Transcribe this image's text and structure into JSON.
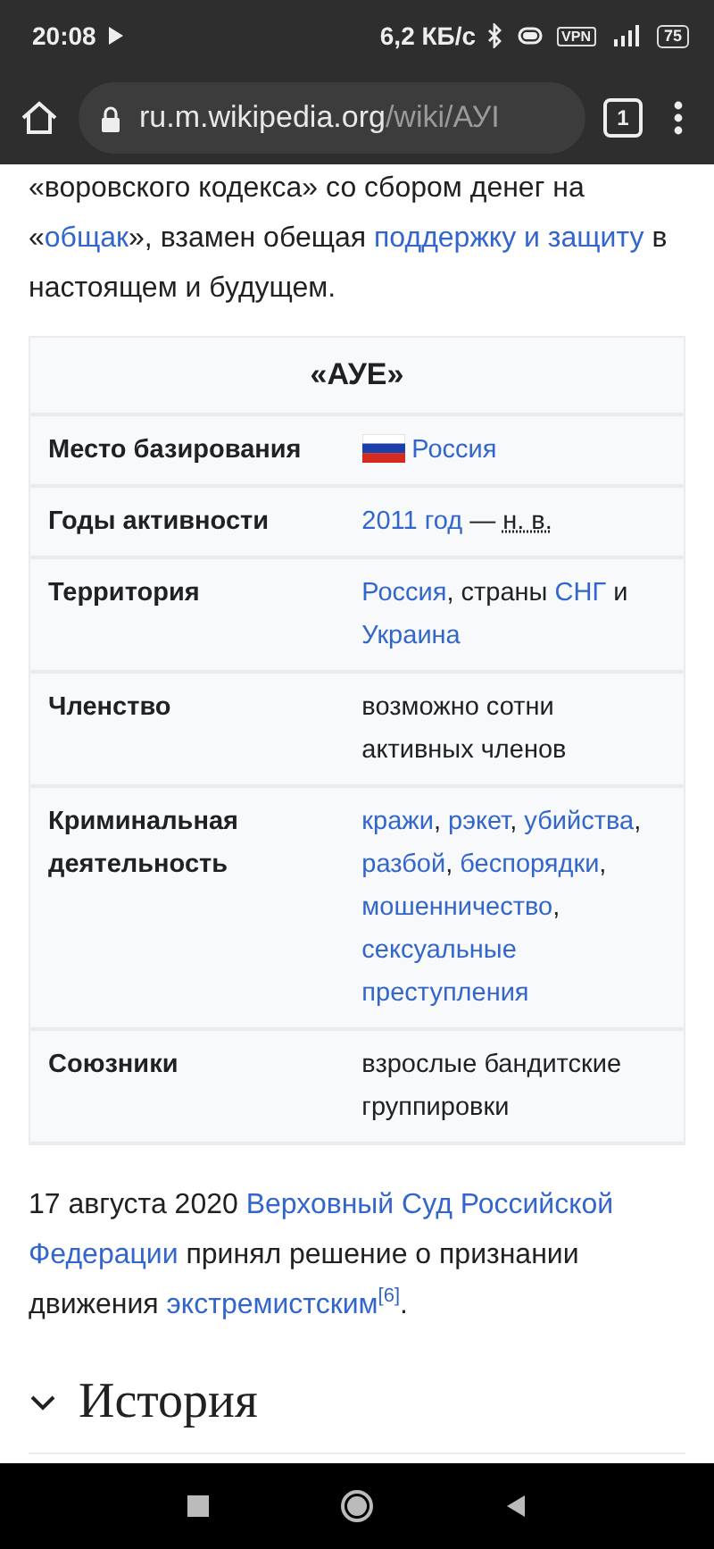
{
  "status_bar": {
    "time": "20:08",
    "speed": "6,2 КБ/с",
    "vpn": "VPN",
    "battery": "75"
  },
  "browser": {
    "url_host": "ru.m.wikipedia.org",
    "url_path": "/wiki/АУI",
    "tab_count": "1"
  },
  "intro": [
    {
      "kind": "text",
      "text": "«воровского кодекса» со сбором денег на «"
    },
    {
      "kind": "link",
      "text": "общак"
    },
    {
      "kind": "text",
      "text": "», взамен обещая "
    },
    {
      "kind": "link",
      "text": "поддержку и защиту"
    },
    {
      "kind": "text",
      "text": " в настоящем и будущем."
    }
  ],
  "infobox": {
    "title": "«АУЕ»",
    "rows": [
      {
        "label": "Место базирования",
        "flag": true,
        "value": [
          {
            "kind": "link",
            "text": "Россия"
          }
        ]
      },
      {
        "label": "Годы активности",
        "flag": false,
        "value": [
          {
            "kind": "link",
            "text": "2011 год"
          },
          {
            "kind": "text",
            "text": " — "
          },
          {
            "kind": "abbr",
            "text": "н. в."
          }
        ]
      },
      {
        "label": "Территория",
        "flag": false,
        "value": [
          {
            "kind": "link",
            "text": "Россия"
          },
          {
            "kind": "text",
            "text": ", страны "
          },
          {
            "kind": "link",
            "text": "СНГ"
          },
          {
            "kind": "text",
            "text": " и "
          },
          {
            "kind": "link",
            "text": "Украина"
          }
        ]
      },
      {
        "label": "Членство",
        "flag": false,
        "value": [
          {
            "kind": "text",
            "text": "возможно сотни активных членов"
          }
        ]
      },
      {
        "label": "Криминальная деятельность",
        "flag": false,
        "value": [
          {
            "kind": "link",
            "text": "кражи"
          },
          {
            "kind": "text",
            "text": ", "
          },
          {
            "kind": "link",
            "text": "рэкет"
          },
          {
            "kind": "text",
            "text": ", "
          },
          {
            "kind": "link",
            "text": "убийства"
          },
          {
            "kind": "text",
            "text": ", "
          },
          {
            "kind": "link",
            "text": "разбой"
          },
          {
            "kind": "text",
            "text": ", "
          },
          {
            "kind": "link",
            "text": "беспорядки"
          },
          {
            "kind": "text",
            "text": ", "
          },
          {
            "kind": "link",
            "text": "мошенничество"
          },
          {
            "kind": "text",
            "text": ", "
          },
          {
            "kind": "link",
            "text": "сексуальные"
          },
          {
            "kind": "link",
            "text": "преступления"
          }
        ]
      },
      {
        "label": "Союзники",
        "flag": false,
        "value": [
          {
            "kind": "text",
            "text": "взрослые бандитские группировки"
          }
        ]
      }
    ]
  },
  "outro": [
    {
      "kind": "text",
      "text": "17 августа 2020 "
    },
    {
      "kind": "link",
      "text": "Верховный Суд Российской"
    },
    {
      "kind": "link",
      "text": "Федерации"
    },
    {
      "kind": "text",
      "text": " принял решение о признании движения "
    },
    {
      "kind": "link",
      "text": "экстремистским"
    },
    {
      "kind": "ref",
      "text": "[6]"
    },
    {
      "kind": "text",
      "text": "."
    }
  ],
  "section": {
    "title": "История",
    "expanded": true
  }
}
